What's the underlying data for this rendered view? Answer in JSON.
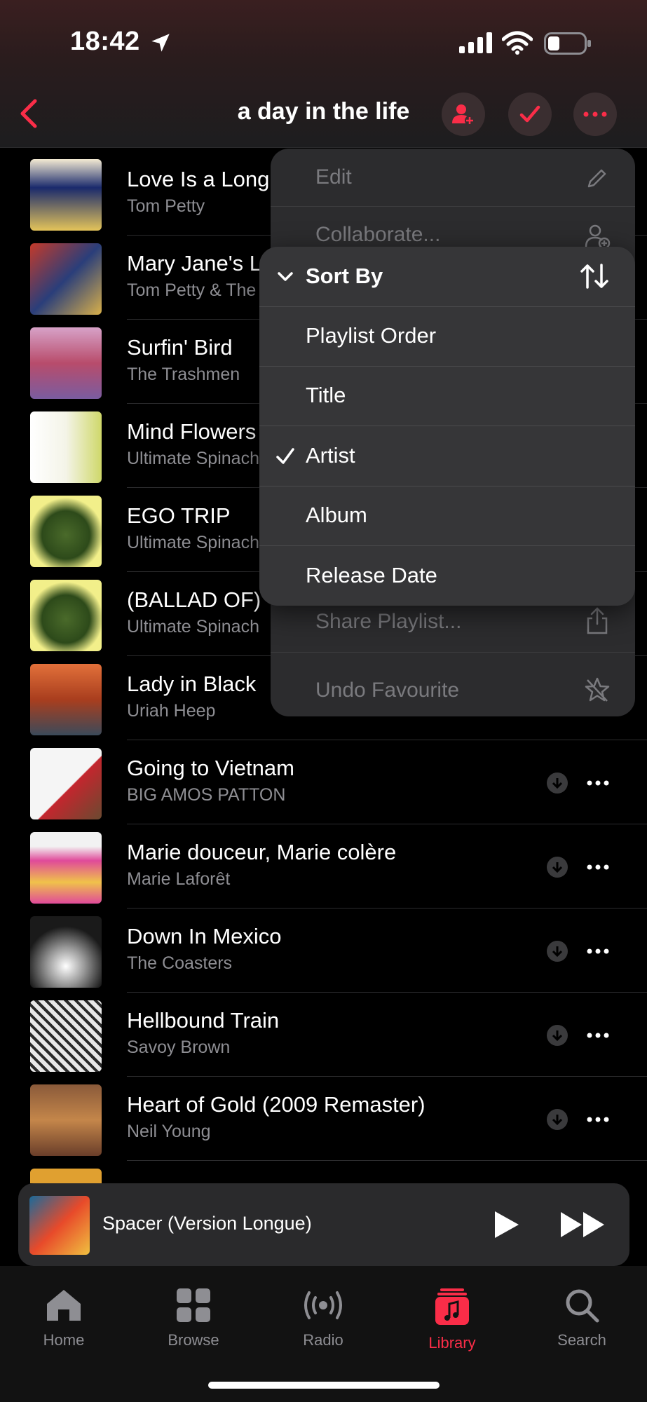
{
  "status_bar": {
    "time": "18:42"
  },
  "header": {
    "title": "a day in the life"
  },
  "songs": [
    {
      "title": "Love Is a Long Road",
      "artist": "Tom Petty"
    },
    {
      "title": "Mary Jane's Last Dance",
      "artist": "Tom Petty & The Heartbreakers"
    },
    {
      "title": "Surfin' Bird",
      "artist": "The Trashmen"
    },
    {
      "title": "Mind Flowers",
      "artist": "Ultimate Spinach"
    },
    {
      "title": "EGO TRIP",
      "artist": "Ultimate Spinach"
    },
    {
      "title": "(BALLAD OF) THE HIP DEATH GODDESS",
      "artist": "Ultimate Spinach"
    },
    {
      "title": "Lady in Black",
      "artist": "Uriah Heep"
    },
    {
      "title": "Going to Vietnam",
      "artist": "BIG AMOS PATTON"
    },
    {
      "title": "Marie douceur, Marie colère",
      "artist": "Marie Laforêt"
    },
    {
      "title": "Down In Mexico",
      "artist": "The Coasters"
    },
    {
      "title": "Hellbound Train",
      "artist": "Savoy Brown"
    },
    {
      "title": "Heart of Gold (2009 Remaster)",
      "artist": "Neil Young"
    }
  ],
  "menu": {
    "edit": "Edit",
    "collaborate": "Collaborate...",
    "share": "Share Playlist...",
    "undo_favourite": "Undo Favourite"
  },
  "sort_menu": {
    "header": "Sort By",
    "options": [
      "Playlist Order",
      "Title",
      "Artist",
      "Album",
      "Release Date"
    ],
    "selected": "Artist"
  },
  "mini_player": {
    "title": "Spacer (Version Longue)"
  },
  "tabs": [
    "Home",
    "Browse",
    "Radio",
    "Library",
    "Search"
  ],
  "active_tab": "Library",
  "colors": {
    "accent": "#fa2d48",
    "secondary_text": "#8e8e93"
  }
}
